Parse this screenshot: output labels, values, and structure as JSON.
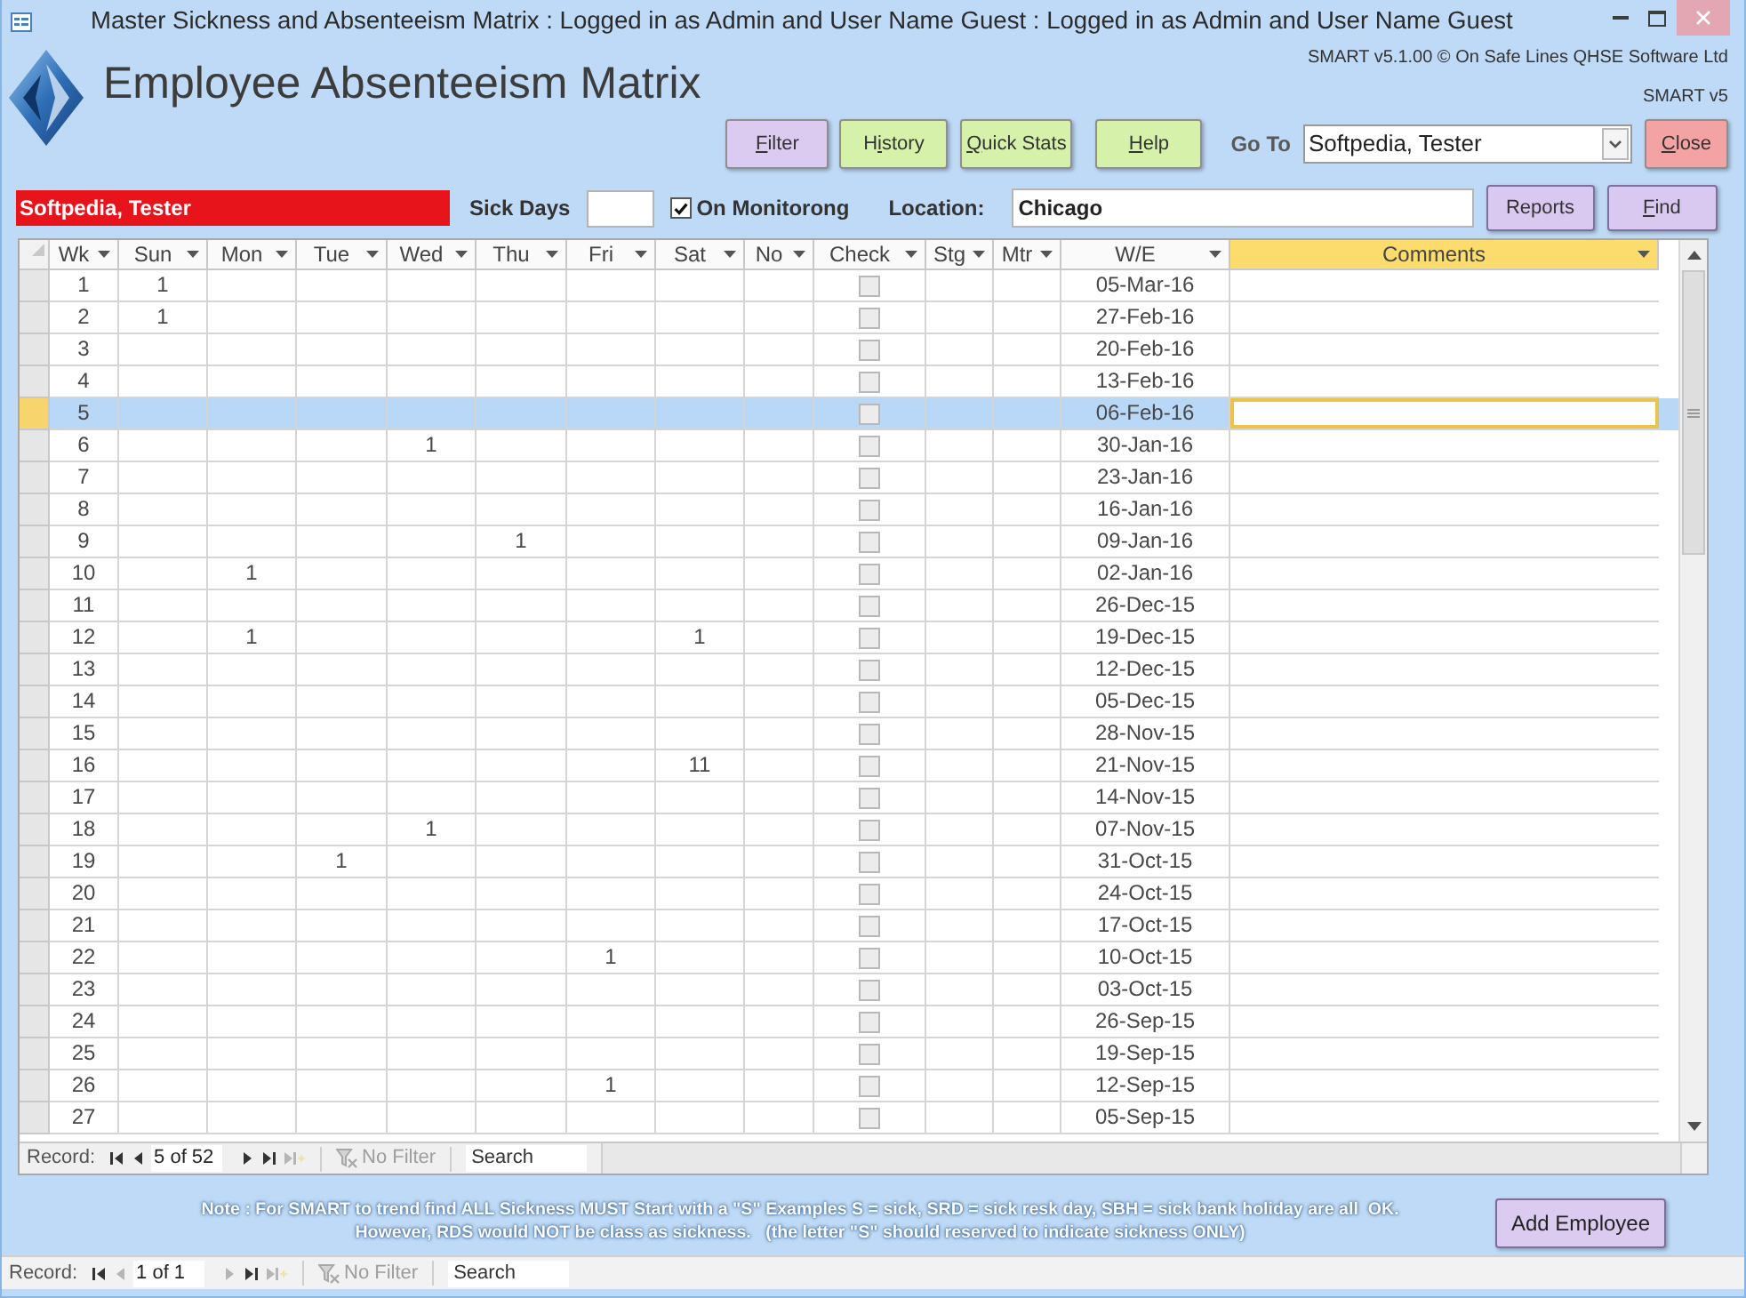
{
  "window": {
    "title": "Master Sickness and Absenteeism Matrix : Logged in as Admin and User Name Guest : Logged in as Admin and User Name Guest"
  },
  "header": {
    "title": "Employee Absenteeism Matrix",
    "copyright": "SMART v5.1.00 © On Safe Lines QHSE Software Ltd",
    "version": "SMART v5"
  },
  "toolbar": {
    "items": [
      {
        "kind": "button",
        "color": "#dccbf0",
        "label_parts": [
          {
            "text": "F",
            "underline": true
          },
          {
            "text": "ilter",
            "underline": false
          }
        ]
      },
      {
        "kind": "button",
        "color": "#d6f1a9",
        "label_parts": [
          {
            "text": "H",
            "underline": false
          },
          {
            "text": "i",
            "underline": true
          },
          {
            "text": "story",
            "underline": false
          }
        ]
      },
      {
        "kind": "button",
        "color": "#d6f1a9",
        "label_parts": [
          {
            "text": "Q",
            "underline": true
          },
          {
            "text": "uick Stats",
            "underline": false
          }
        ]
      },
      {
        "kind": "button",
        "color": "#d6f1a9",
        "label_parts": [
          {
            "text": "H",
            "underline": true
          },
          {
            "text": "elp",
            "underline": false
          }
        ]
      },
      {
        "kind": "combo",
        "label": "Go To",
        "value": "Softpedia, Tester"
      },
      {
        "kind": "button",
        "color": "#f3a3a3",
        "label_parts": [
          {
            "text": "C",
            "underline": true
          },
          {
            "text": "lose",
            "underline": false
          }
        ]
      }
    ]
  },
  "employee_bar": {
    "name": "Softpedia, Tester",
    "sick_days": {
      "label": "Sick Days"
    },
    "monitoring": {
      "label": "On Monitorong",
      "checked": true
    },
    "location": {
      "label": "Location:",
      "value": "Chicago"
    },
    "buttons": [
      {
        "label_parts": [
          {
            "text": "Reports",
            "underline": false
          }
        ]
      },
      {
        "label_parts": [
          {
            "text": "F",
            "underline": true
          },
          {
            "text": "ind",
            "underline": false
          }
        ]
      }
    ]
  },
  "datasheet": {
    "columns": [
      {
        "label": "Wk",
        "selected": false
      },
      {
        "label": "Sun",
        "selected": false
      },
      {
        "label": "Mon",
        "selected": false
      },
      {
        "label": "Tue",
        "selected": false
      },
      {
        "label": "Wed",
        "selected": false
      },
      {
        "label": "Thu",
        "selected": false
      },
      {
        "label": "Fri",
        "selected": false
      },
      {
        "label": "Sat",
        "selected": false
      },
      {
        "label": "No",
        "selected": false
      },
      {
        "label": "Check",
        "selected": false
      },
      {
        "label": "Stg",
        "selected": false
      },
      {
        "label": "Mtr",
        "selected": false
      },
      {
        "label": "W/E",
        "selected": false
      },
      {
        "label": "Comments",
        "selected": true
      }
    ],
    "rows": [
      {
        "wk": "1",
        "sun": "1",
        "check": false,
        "we": "05-Mar-16",
        "selected": false
      },
      {
        "wk": "2",
        "sun": "1",
        "check": false,
        "we": "27-Feb-16",
        "selected": false
      },
      {
        "wk": "3",
        "check": false,
        "we": "20-Feb-16",
        "selected": false
      },
      {
        "wk": "4",
        "check": false,
        "we": "13-Feb-16",
        "selected": false
      },
      {
        "wk": "5",
        "check": false,
        "we": "06-Feb-16",
        "selected": true
      },
      {
        "wk": "6",
        "wed": "1",
        "check": false,
        "we": "30-Jan-16",
        "selected": false
      },
      {
        "wk": "7",
        "check": false,
        "we": "23-Jan-16",
        "selected": false
      },
      {
        "wk": "8",
        "check": false,
        "we": "16-Jan-16",
        "selected": false
      },
      {
        "wk": "9",
        "thu": "1",
        "check": false,
        "we": "09-Jan-16",
        "selected": false
      },
      {
        "wk": "10",
        "mon": "1",
        "check": false,
        "we": "02-Jan-16",
        "selected": false
      },
      {
        "wk": "11",
        "check": false,
        "we": "26-Dec-15",
        "selected": false
      },
      {
        "wk": "12",
        "mon": "1",
        "sat": "1",
        "check": false,
        "we": "19-Dec-15",
        "selected": false
      },
      {
        "wk": "13",
        "check": false,
        "we": "12-Dec-15",
        "selected": false
      },
      {
        "wk": "14",
        "check": false,
        "we": "05-Dec-15",
        "selected": false
      },
      {
        "wk": "15",
        "check": false,
        "we": "28-Nov-15",
        "selected": false
      },
      {
        "wk": "16",
        "sat": "11",
        "check": false,
        "we": "21-Nov-15",
        "selected": false
      },
      {
        "wk": "17",
        "check": false,
        "we": "14-Nov-15",
        "selected": false
      },
      {
        "wk": "18",
        "wed": "1",
        "check": false,
        "we": "07-Nov-15",
        "selected": false
      },
      {
        "wk": "19",
        "tue": "1",
        "check": false,
        "we": "31-Oct-15",
        "selected": false
      },
      {
        "wk": "20",
        "check": false,
        "we": "24-Oct-15",
        "selected": false
      },
      {
        "wk": "21",
        "check": false,
        "we": "17-Oct-15",
        "selected": false
      },
      {
        "wk": "22",
        "fri": "1",
        "check": false,
        "we": "10-Oct-15",
        "selected": false
      },
      {
        "wk": "23",
        "check": false,
        "we": "03-Oct-15",
        "selected": false
      },
      {
        "wk": "24",
        "check": false,
        "we": "26-Sep-15",
        "selected": false
      },
      {
        "wk": "25",
        "check": false,
        "we": "19-Sep-15",
        "selected": false
      },
      {
        "wk": "26",
        "fri": "1",
        "check": false,
        "we": "12-Sep-15",
        "selected": false
      },
      {
        "wk": "27",
        "check": false,
        "we": "05-Sep-15",
        "selected": false
      }
    ],
    "navigation": {
      "label": "Record:",
      "buttons": [
        {
          "kind": "first",
          "disabled": false
        },
        {
          "kind": "previous",
          "disabled": false
        },
        {
          "kind": "next",
          "disabled": false
        },
        {
          "kind": "last",
          "disabled": false
        },
        {
          "kind": "new",
          "disabled": true
        }
      ],
      "position": "5 of 52",
      "filter": "No Filter",
      "search_placeholder": "Search"
    }
  },
  "note": {
    "lines": [
      "Note : For SMART to trend find ALL Sickness MUST Start with a \"S\" Examples S = sick, SRD = sick resk day, SBH = sick bank holiday are all  OK.",
      "However, RDS would NOT be class as sickness.   (the letter \"S\" should reserved to indicate sickness ONLY)"
    ]
  },
  "add_employee_button": {
    "label": "Add Employee"
  },
  "form_navigation": {
    "label": "Record:",
    "buttons": [
      {
        "kind": "first",
        "disabled": false
      },
      {
        "kind": "previous",
        "disabled": true
      },
      {
        "kind": "next",
        "disabled": true
      },
      {
        "kind": "last",
        "disabled": false
      },
      {
        "kind": "new",
        "disabled": true
      }
    ],
    "position": "1 of 1",
    "filter": "No Filter",
    "search_placeholder": "Search"
  }
}
